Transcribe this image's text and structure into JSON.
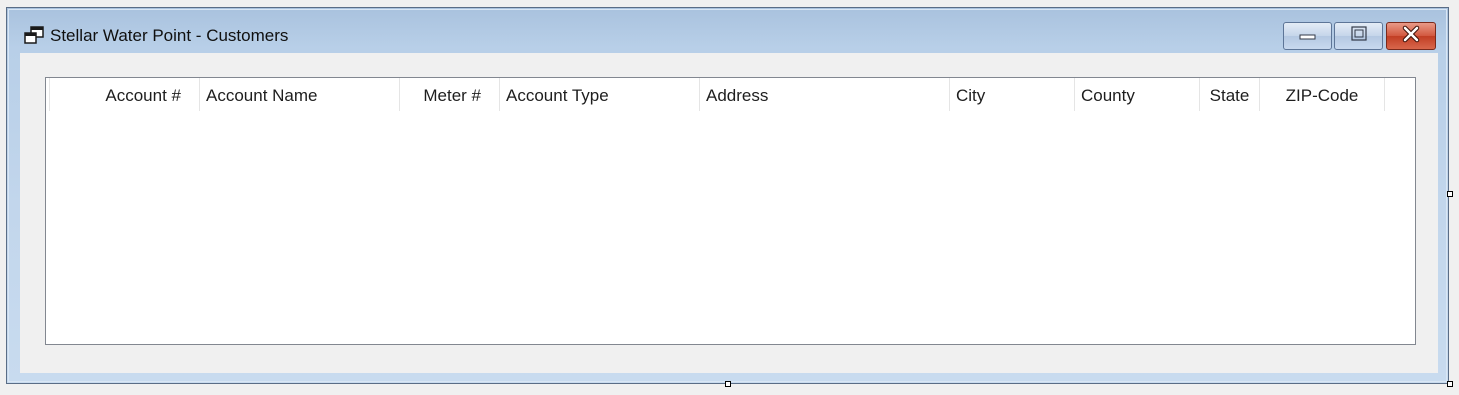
{
  "window": {
    "title": "Stellar Water Point - Customers",
    "icon": "app-window-icon"
  },
  "caption_buttons": {
    "minimize": "minimize-icon",
    "maximize": "maximize-icon",
    "close": "close-icon"
  },
  "customers_list": {
    "columns": [
      {
        "label": "Account #",
        "align": "right"
      },
      {
        "label": "Account Name",
        "align": "left"
      },
      {
        "label": "Meter #",
        "align": "right"
      },
      {
        "label": "Account Type",
        "align": "left"
      },
      {
        "label": "Address",
        "align": "left"
      },
      {
        "label": "City",
        "align": "left"
      },
      {
        "label": "County",
        "align": "left"
      },
      {
        "label": "State",
        "align": "center"
      },
      {
        "label": "ZIP-Code",
        "align": "center"
      }
    ],
    "rows": []
  },
  "colors": {
    "title_gradient_top": "#a9c2de",
    "close_button": "#c13e24",
    "client_background": "#f0f0f0",
    "list_background": "#ffffff"
  }
}
